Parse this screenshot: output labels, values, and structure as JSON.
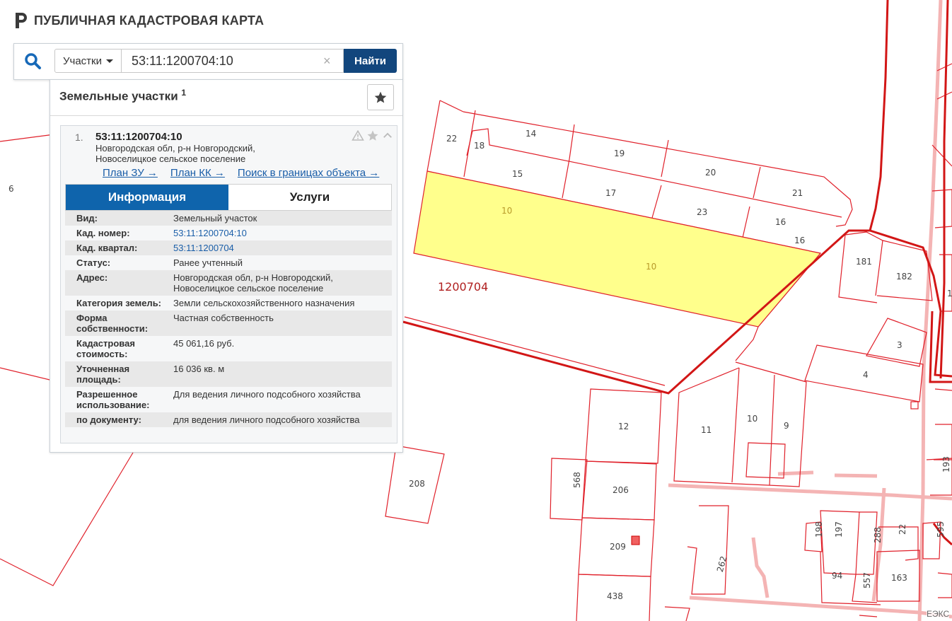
{
  "header": {
    "title": "ПУБЛИЧНАЯ КАДАСТРОВАЯ КАРТА"
  },
  "search": {
    "type_label": "Участки",
    "query": "53:11:1200704:10",
    "clear_symbol": "×",
    "find_label": "Найти"
  },
  "results": {
    "title": "Земельные участки",
    "count": "1",
    "items": [
      {
        "num": "1.",
        "id": "53:11:1200704:10",
        "address_line1": "Новгородская обл, р-н Новгородский,",
        "address_line2": "Новоселицкое сельское поселение",
        "links": [
          "План ЗУ →",
          "План КК →",
          "Поиск в границах объекта →"
        ],
        "tabs": [
          "Информация",
          "Услуги"
        ],
        "info": [
          {
            "k": "Вид:",
            "v": "Земельный участок"
          },
          {
            "k": "Кад. номер:",
            "v": "53:11:1200704:10"
          },
          {
            "k": "Кад. квартал:",
            "v": "53:11:1200704"
          },
          {
            "k": "Статус:",
            "v": "Ранее учтенный"
          },
          {
            "k": "Адрес:",
            "v1": "Новгородская обл, р-н Новгородский,",
            "v2": "Новоселицкое сельское поселение"
          },
          {
            "k": "Категория земель:",
            "v": "Земли сельскохозяйственного назначения"
          },
          {
            "k1": "Форма",
            "k2": "собственности:",
            "v": "Частная собственность"
          },
          {
            "k1": "Кадастровая",
            "k2": "стоимость:",
            "v": "45 061,16 руб."
          },
          {
            "k1": "Уточненная",
            "k2": "площадь:",
            "v": "16 036 кв. м"
          },
          {
            "k1": "Разрешенное",
            "k2": "использование:",
            "v": "Для ведения личного подсобного хозяйства"
          },
          {
            "k": "по документу:",
            "v": "для ведения личного подсобного хозяйства"
          }
        ]
      }
    ]
  },
  "map": {
    "quarter_label": "1200704",
    "parcel_labels": {
      "p6": "6",
      "p22": "22",
      "p14": "14",
      "p18": "18",
      "p19": "19",
      "p20": "20",
      "p21": "21",
      "p15": "15",
      "p17": "17",
      "p23": "23",
      "p16a": "16",
      "p16b": "16",
      "p10a": "10",
      "p10b": "10",
      "p181": "181",
      "p182": "182",
      "p3": "3",
      "p4": "4",
      "p12": "12",
      "p11": "11",
      "p10c": "10",
      "p9": "9",
      "p208": "208",
      "p568": "568",
      "p206": "206",
      "p209": "209",
      "p438": "438",
      "p262": "262",
      "p198": "198",
      "p197": "197",
      "p288": "288",
      "p22b": "22",
      "p94": "94",
      "p557": "557",
      "p163": "163",
      "p193": "193",
      "p595": "595",
      "p1x": "1"
    },
    "colors": {
      "boundary": "#e0202a",
      "selected_fill": "#ffff8c",
      "road": "#f4b4b4"
    },
    "attribution": "ЕЭКС"
  }
}
